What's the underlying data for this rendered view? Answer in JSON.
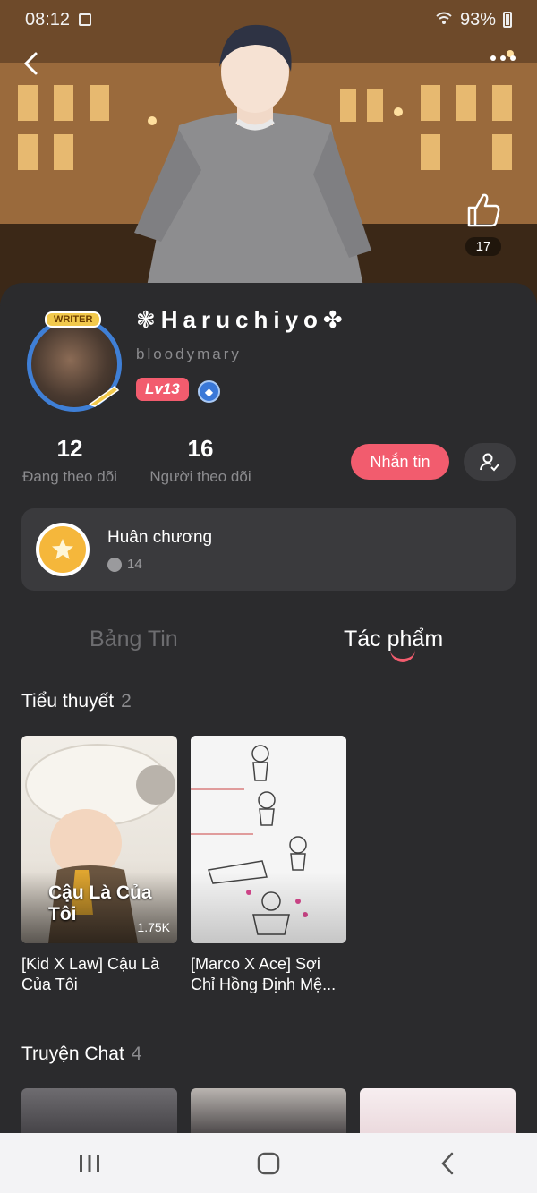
{
  "status_bar": {
    "time": "08:12",
    "battery": "93%"
  },
  "header": {
    "like_count": "17"
  },
  "profile": {
    "avatar_badge": "WRITER",
    "name": "❃Haruchiyo✤",
    "handle": "bloodymary",
    "level": "Lv13",
    "following_count": "12",
    "following_label": "Đang theo dõi",
    "followers_count": "16",
    "followers_label": "Người theo dõi",
    "message_button": "Nhắn tin"
  },
  "medals": {
    "title": "Huân chương",
    "count": "14"
  },
  "tabs": [
    {
      "label": "Bảng Tin",
      "active": false
    },
    {
      "label": "Tác phẩm",
      "active": true
    }
  ],
  "novels": {
    "title": "Tiểu thuyết",
    "count": "2",
    "items": [
      {
        "title": "[Kid X Law] Cậu Là Của Tôi",
        "views": "1.75K",
        "cover_text": "Cậu Là Của Tôi"
      },
      {
        "title": "[Marco X Ace] Sợi Chỉ Hồng Định Mệ..."
      }
    ]
  },
  "chat_stories": {
    "title": "Truyện Chat",
    "count": "4"
  },
  "colors": {
    "accent": "#f25c6e",
    "background": "#2b2b2d",
    "card": "#3a3a3d"
  }
}
